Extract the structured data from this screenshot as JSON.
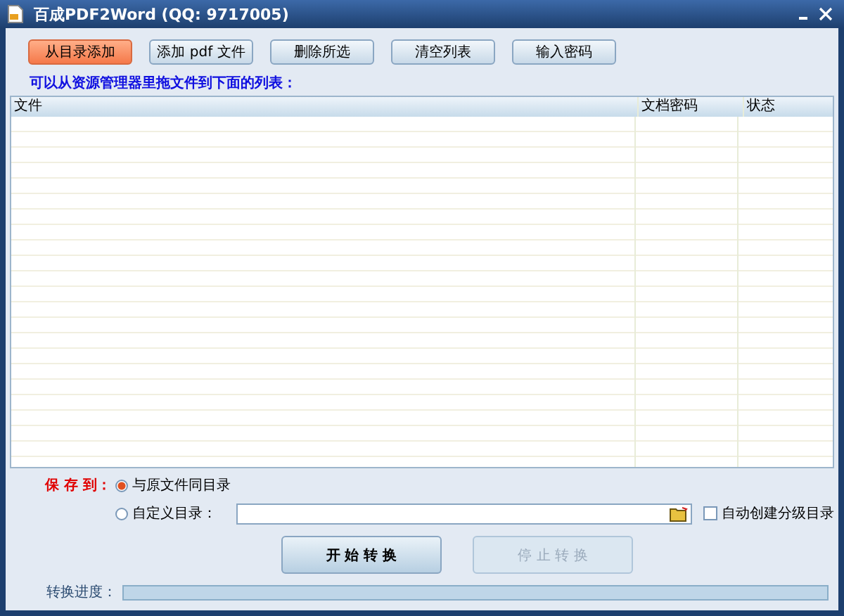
{
  "window": {
    "title": "百成PDF2Word (QQ: 9717005)"
  },
  "toolbar": [
    {
      "label": "从目录添加",
      "selected": true
    },
    {
      "label": "添加 pdf 文件",
      "selected": false
    },
    {
      "label": "删除所选",
      "selected": false
    },
    {
      "label": "清空列表",
      "selected": false
    },
    {
      "label": "输入密码",
      "selected": false
    }
  ],
  "hint": "可以从资源管理器里拖文件到下面的列表：",
  "table": {
    "columns": [
      "文件",
      "文档密码",
      "状态"
    ]
  },
  "save": {
    "label": "保 存 到：",
    "options": [
      {
        "label": "与原文件同目录",
        "selected": true
      },
      {
        "label": "自定义目录：",
        "selected": false
      }
    ],
    "auto_subdir": {
      "label": "自动创建分级目录",
      "checked": false
    }
  },
  "actions": [
    {
      "label": "开 始 转 换",
      "disabled": false
    },
    {
      "label": "停 止 转 换",
      "disabled": true
    }
  ],
  "progress": {
    "label": "转换进度：",
    "level": 0
  }
}
